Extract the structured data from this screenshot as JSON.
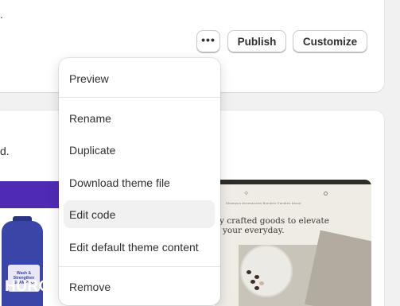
{
  "top_card": {
    "partial_text": ".",
    "more_label": "•••",
    "publish_label": "Publish",
    "customize_label": "Customize"
  },
  "second_card": {
    "partial_text": "d."
  },
  "preview_left": {
    "brand": "HURON.",
    "bottle_label": "Wash & Strengthen SHAMPOO"
  },
  "preview_right": {
    "nav": "Shampoo   Accessories   Bundles   Candles   About",
    "heading_line1": "y crafted goods to elevate",
    "heading_line2": "your everyday."
  },
  "menu": {
    "items": [
      {
        "label": "Preview"
      },
      {
        "label": "Rename"
      },
      {
        "label": "Duplicate"
      },
      {
        "label": "Download theme file"
      },
      {
        "label": "Edit code"
      },
      {
        "label": "Edit default theme content"
      },
      {
        "label": "Remove"
      }
    ],
    "active_item": "Edit code"
  },
  "colors": {
    "background": "#f1f1f1",
    "card": "#ffffff",
    "menu_hover": "#f1f1f1",
    "purple_banner": "#4f2bb5",
    "bottle": "#3a45a8"
  }
}
